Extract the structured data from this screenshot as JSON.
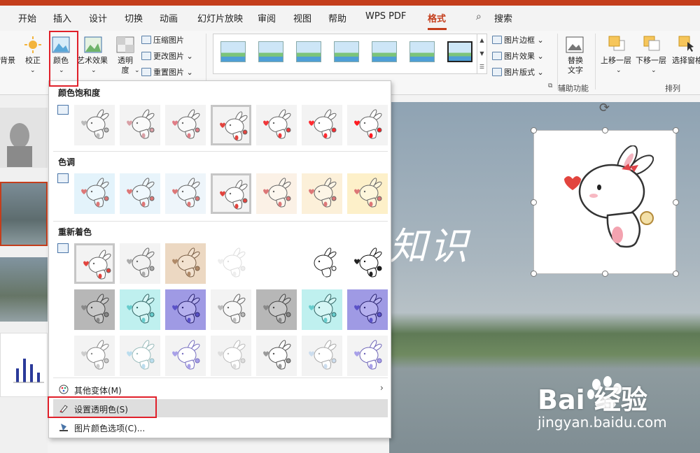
{
  "menu": {
    "tabs": [
      "开始",
      "插入",
      "设计",
      "切换",
      "动画",
      "幻灯片放映",
      "审阅",
      "视图",
      "帮助",
      "WPS PDF",
      "格式"
    ],
    "active_tab": "格式",
    "search_label": "搜索"
  },
  "ribbon": {
    "background_btn": "背景",
    "correct_btn": "校正",
    "color_btn": "颜色",
    "art_btn": "艺术效果",
    "transparency_btn": "透明度",
    "compress_btn": "压缩图片",
    "change_btn": "更改图片",
    "reset_btn": "重置图片",
    "border_btn": "图片边框",
    "effects_btn": "图片效果",
    "layout_btn": "图片版式",
    "alt_text_btn": "替换文字",
    "bring_forward_btn": "上移一层",
    "send_backward_btn": "下移一层",
    "selection_pane_btn": "选择窗格",
    "group_accessibility": "辅助功能",
    "group_arrange": "排列"
  },
  "dropdown": {
    "saturation_title": "颜色饱和度",
    "tone_title": "色调",
    "recolor_title": "重新着色",
    "more_variations": "其他变体(M)",
    "set_transparent": "设置透明色(S)",
    "color_options": "图片颜色选项(C)..."
  },
  "watermark": {
    "brand": "Bai  经验",
    "url": "jingyan.baidu.com"
  },
  "colors": {
    "accent": "#c43e1c",
    "highlight": "#e0202a"
  }
}
